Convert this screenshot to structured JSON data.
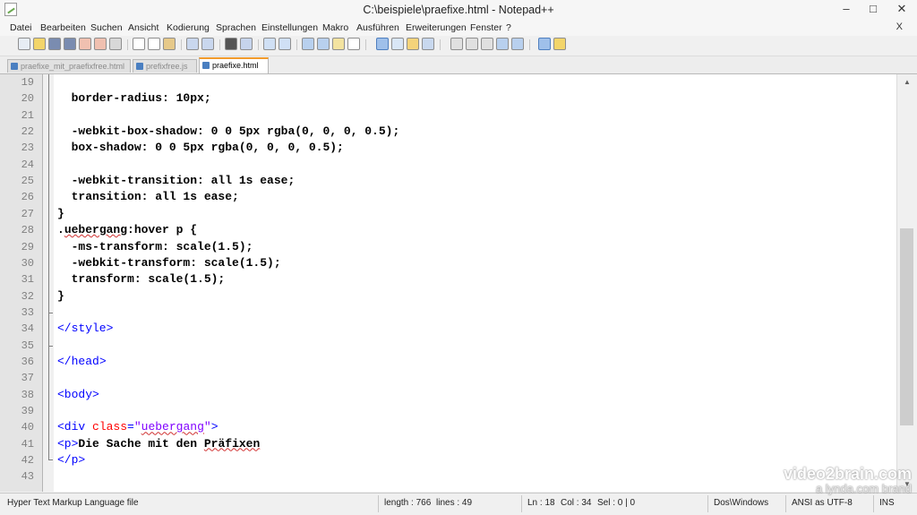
{
  "window": {
    "title": "C:\\beispiele\\praefixe.html - Notepad++",
    "minimize": "–",
    "maximize": "□",
    "close": "✕"
  },
  "menu": {
    "items": [
      "Datei",
      "Bearbeiten",
      "Suchen",
      "Ansicht",
      "Kodierung",
      "Sprachen",
      "Einstellungen",
      "Makro",
      "Ausführen",
      "Erweiterungen",
      "Fenster",
      "?"
    ],
    "close": "X"
  },
  "toolbar": {
    "icons": [
      "new-file-icon",
      "open-file-icon",
      "save-icon",
      "save-all-icon",
      "close-icon",
      "close-all-icon",
      "print-icon",
      "cut-icon",
      "copy-icon",
      "paste-icon",
      "undo-icon",
      "redo-icon",
      "find-icon",
      "replace-icon",
      "zoom-in-icon",
      "zoom-out-icon",
      "sync-v-icon",
      "sync-h-icon",
      "word-wrap-icon",
      "all-chars-icon",
      "indent-guide-icon",
      "lang-icon",
      "folder-icon",
      "monitor-icon",
      "record-icon",
      "stop-icon",
      "play-icon",
      "play-multi-icon",
      "save-macro-icon",
      "spellcheck-icon",
      "doc-map-icon"
    ]
  },
  "tabs": [
    {
      "label": "praefixe_mit_praefixfree.html",
      "active": false
    },
    {
      "label": "prefixfree.js",
      "active": false
    },
    {
      "label": "praefixe.html",
      "active": true
    }
  ],
  "editor": {
    "lines": [
      {
        "num": "19",
        "html": ""
      },
      {
        "num": "20",
        "html": "  border-radius: 10px;"
      },
      {
        "num": "21",
        "html": ""
      },
      {
        "num": "22",
        "html": "  -webkit-box-shadow: 0 0 5px rgba(0, 0, 0, 0.5);"
      },
      {
        "num": "23",
        "html": "  box-shadow: 0 0 5px rgba(0, 0, 0, 0.5);"
      },
      {
        "num": "24",
        "html": ""
      },
      {
        "num": "25",
        "html": "  -webkit-transition: all 1s ease;"
      },
      {
        "num": "26",
        "html": "  transition: all 1s ease;"
      },
      {
        "num": "27",
        "html": "}"
      },
      {
        "num": "28",
        "html": ".uebergang:hover p {"
      },
      {
        "num": "29",
        "html": "  -ms-transform: scale(1.5);"
      },
      {
        "num": "30",
        "html": "  -webkit-transform: scale(1.5);"
      },
      {
        "num": "31",
        "html": "  transform: scale(1.5);"
      },
      {
        "num": "32",
        "html": "}"
      },
      {
        "num": "33",
        "html": ""
      },
      {
        "num": "34",
        "html": "</style>"
      },
      {
        "num": "35",
        "html": ""
      },
      {
        "num": "36",
        "html": "</head>"
      },
      {
        "num": "37",
        "html": ""
      },
      {
        "num": "38",
        "html": "<body>"
      },
      {
        "num": "39",
        "html": ""
      },
      {
        "num": "40",
        "html": "<div class=\"uebergang\">"
      },
      {
        "num": "41",
        "html": "<p>Die Sache mit den Präfixen"
      },
      {
        "num": "42",
        "html": "</p>"
      },
      {
        "num": "43",
        "html": ""
      }
    ]
  },
  "status": {
    "file_type": "Hyper Text Markup Language file",
    "length": "length : 766",
    "lines": "lines : 49",
    "ln": "Ln : 18",
    "col": "Col : 34",
    "sel": "Sel : 0 | 0",
    "eol": "Dos\\Windows",
    "encoding": "ANSI as UTF-8",
    "mode": "INS"
  },
  "watermark": {
    "line1": "video2brain.com",
    "line2": "a lynda.com brand"
  },
  "colors": {
    "tag": "#0000ff",
    "attribute": "#ff0000",
    "string": "#8000ff",
    "active_tab_accent": "#f29b2c"
  }
}
